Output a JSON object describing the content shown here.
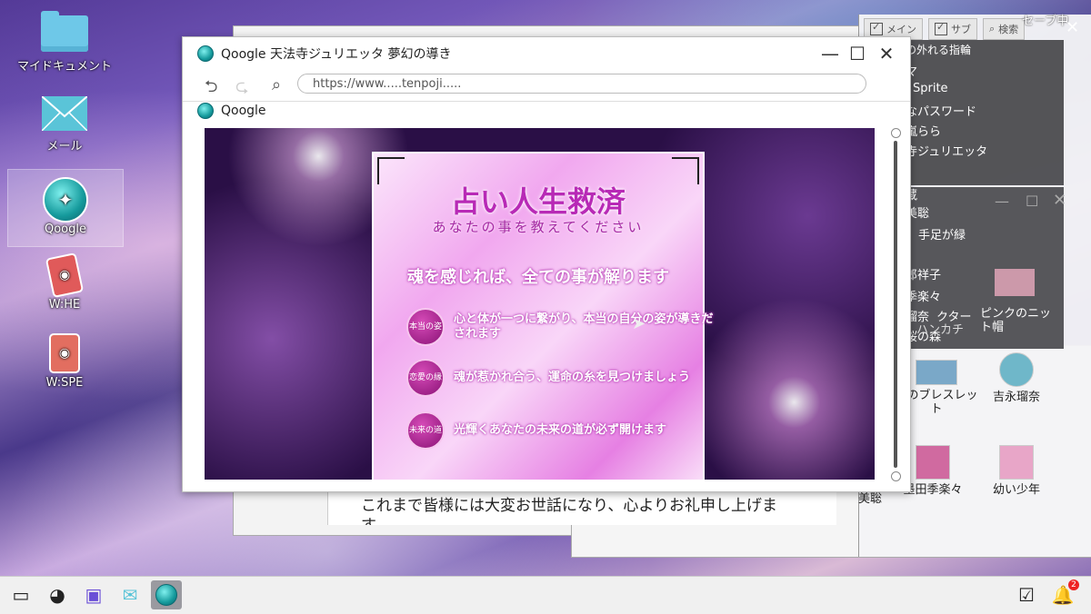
{
  "desktop": {
    "icons": [
      {
        "label": "マイドキュメント",
        "icon": "folder-icon"
      },
      {
        "label": "メール",
        "icon": "mail-icon"
      },
      {
        "label": "Qoogle",
        "icon": "qoogle-icon"
      },
      {
        "label": "W:HE",
        "icon": "card-icon"
      },
      {
        "label": "W:SPE",
        "icon": "card-icon"
      }
    ]
  },
  "right_panel": {
    "save_status": "セーブ中",
    "tabs": [
      {
        "label": "メイン"
      },
      {
        "label": "サブ"
      },
      {
        "label": "検索"
      }
    ],
    "list": [
      "の外れる指輪",
      "マ",
      "Sprite",
      "なパスワード",
      "嵐らら",
      "寺ジュリエッタ",
      "蔵",
      "美聡"
    ],
    "sub_label": "手足が緑",
    "names": [
      "郎祥子",
      "季楽々",
      "瑠奈",
      "桜の森"
    ],
    "items": [
      {
        "label": "ハンカチ"
      },
      {
        "label": "ピンクのニット帽"
      },
      {
        "label": "永のブレスレット"
      },
      {
        "label": "吉永瑠奈"
      },
      {
        "label": "墨田季楽々"
      },
      {
        "label": "幼い少年"
      }
    ],
    "misc": [
      "クター",
      "美聡"
    ]
  },
  "browser": {
    "title": "Qoogle 天法寺ジュリエッタ 夢幻の導き",
    "url": "https://www.....tenpoji.....",
    "bookmark": "Qoogle",
    "page": {
      "title": "占い人生救済",
      "subtitle": "あなたの事を教えてください",
      "headline": "魂を感じれば、全ての事が解ります",
      "items": [
        {
          "badge": "本当の姿",
          "text": "心と体が一つに繋がり、本当の自分の姿が導きだされます"
        },
        {
          "badge": "恋愛の縁",
          "text": "魂が惹かれ合う、運命の糸を見つけましょう"
        },
        {
          "badge": "未来の道",
          "text": "光輝くあなたの未来の道が必ず開けます"
        }
      ]
    }
  },
  "text_window": {
    "text": "これまで皆様には大変お世話になり、心よりお礼申し上げます。"
  },
  "taskbar": {
    "notification_count": "2"
  }
}
